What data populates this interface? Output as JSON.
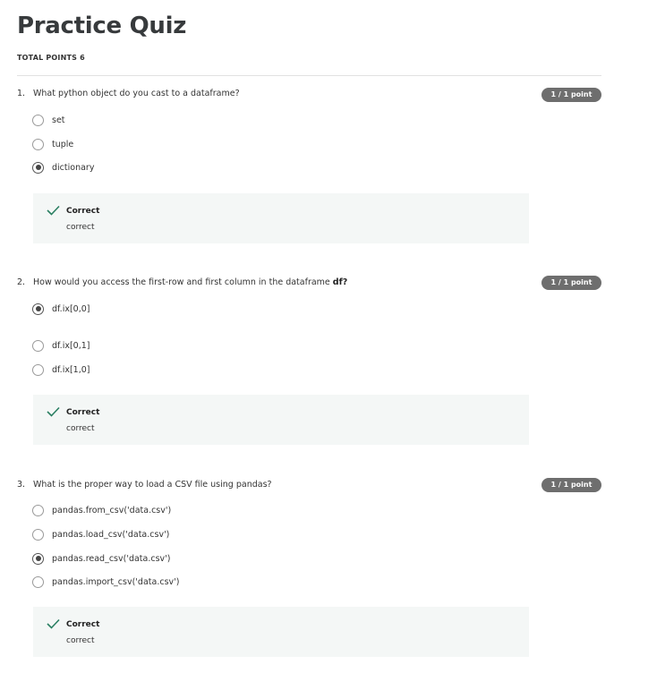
{
  "quiz": {
    "title": "Practice Quiz",
    "total_points": "TOTAL POINTS 6"
  },
  "questions": [
    {
      "number": "1.",
      "text": "What python object do you cast to a dataframe?",
      "text_bold": "",
      "score": "1 / 1 point",
      "options": [
        {
          "label": "set",
          "selected": false
        },
        {
          "label": "tuple",
          "selected": false
        },
        {
          "label": "dictionary",
          "selected": true
        }
      ],
      "feedback": {
        "title": "Correct",
        "text": "correct"
      }
    },
    {
      "number": "2.",
      "text": "How would you access the first-row and first column in the dataframe ",
      "text_bold": "df?",
      "score": "1 / 1 point",
      "options": [
        {
          "label": "df.ix[0,0]",
          "selected": true
        },
        {
          "label": "df.ix[0,1]",
          "selected": false
        },
        {
          "label": "df.ix[1,0]",
          "selected": false
        }
      ],
      "feedback": {
        "title": "Correct",
        "text": "correct"
      }
    },
    {
      "number": "3.",
      "text": "What is the proper way to load a CSV file using pandas?",
      "text_bold": "",
      "score": "1 / 1 point",
      "options": [
        {
          "label": "pandas.from_csv('data.csv')",
          "selected": false
        },
        {
          "label": "pandas.load_csv('data.csv')",
          "selected": false
        },
        {
          "label": "pandas.read_csv('data.csv')",
          "selected": true
        },
        {
          "label": "pandas.import_csv('data.csv')",
          "selected": false
        }
      ],
      "feedback": {
        "title": "Correct",
        "text": "correct"
      }
    }
  ],
  "colors": {
    "badge": "#6e6e6e",
    "check": "#2a7f62",
    "feedback_bg": "#f4f7f6"
  }
}
